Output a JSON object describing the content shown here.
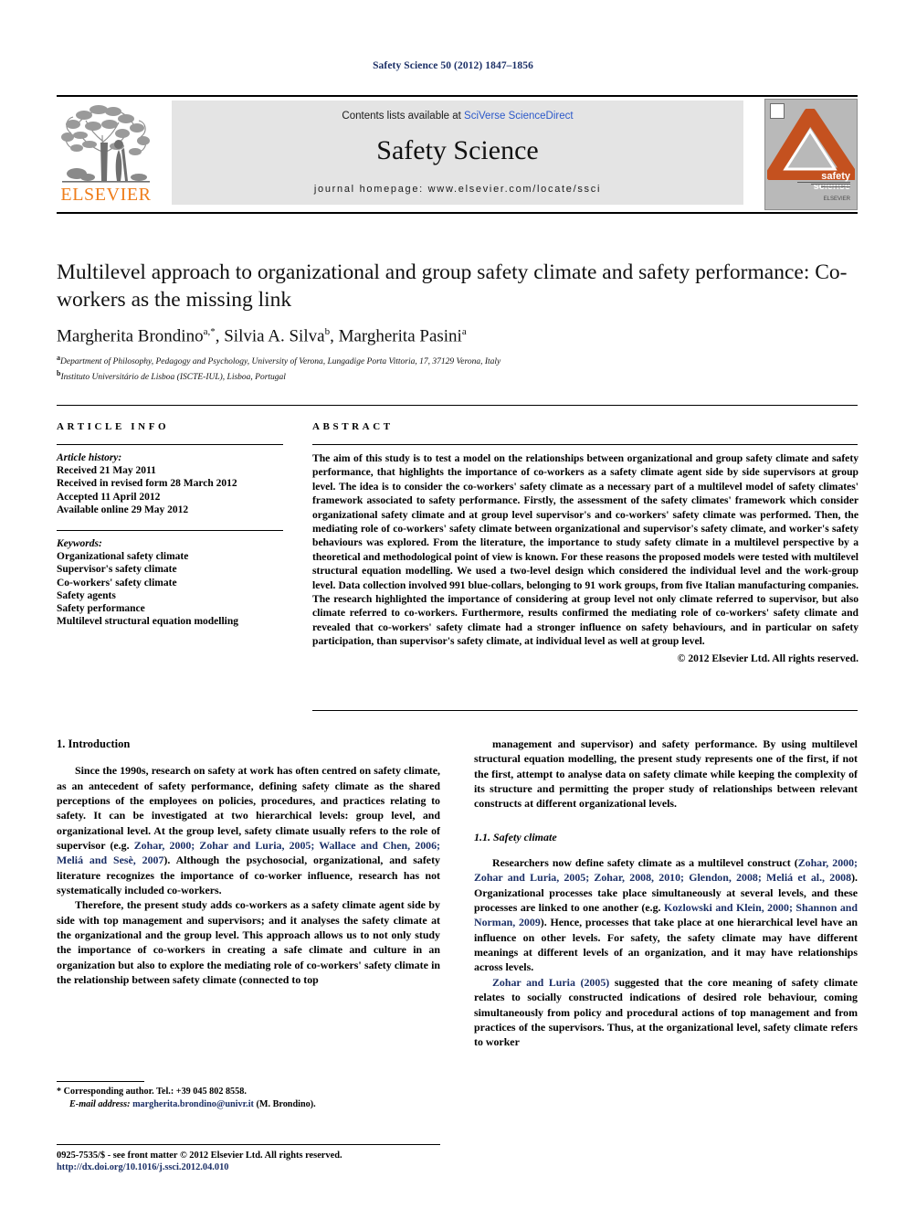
{
  "running_head": "Safety Science 50 (2012) 1847–1856",
  "masthead": {
    "publisher_wordmark": "ELSEVIER",
    "publisher_logo_icon": "elsevier-tree-icon",
    "contents_prefix": "Contents lists available at ",
    "contents_link": "SciVerse ScienceDirect",
    "journal_name": "Safety Science",
    "homepage": "journal homepage: www.elsevier.com/locate/ssci",
    "cover": {
      "title_line1": "safety",
      "title_line2": "science",
      "publisher_small": "ELSEVIER",
      "accent_color": "#c4511f",
      "background_color": "#b9b9b9"
    }
  },
  "article": {
    "title": "Multilevel approach to organizational and group safety climate and safety performance: Co-workers as the missing link",
    "authors": [
      {
        "name": "Margherita Brondino",
        "marks": "a,*"
      },
      {
        "name": "Silvia A. Silva",
        "marks": "b"
      },
      {
        "name": "Margherita Pasini",
        "marks": "a"
      }
    ],
    "affiliations": [
      {
        "mark": "a",
        "text": "Department of Philosophy, Pedagogy and Psychology, University of Verona, Lungadige Porta Vittoria, 17, 37129 Verona, Italy"
      },
      {
        "mark": "b",
        "text": "Instituto Universitário de Lisboa (ISCTE-IUL), Lisboa, Portugal"
      }
    ]
  },
  "article_info": {
    "heading": "ARTICLE INFO",
    "history_label": "Article history:",
    "history": [
      "Received 21 May 2011",
      "Received in revised form 28 March 2012",
      "Accepted 11 April 2012",
      "Available online 29 May 2012"
    ],
    "keywords_label": "Keywords:",
    "keywords": [
      "Organizational safety climate",
      "Supervisor's safety climate",
      "Co-workers' safety climate",
      "Safety agents",
      "Safety performance",
      "Multilevel structural equation modelling"
    ]
  },
  "abstract": {
    "heading": "ABSTRACT",
    "text": "The aim of this study is to test a model on the relationships between organizational and group safety climate and safety performance, that highlights the importance of co-workers as a safety climate agent side by side supervisors at group level. The idea is to consider the co-workers' safety climate as a necessary part of a multilevel model of safety climates' framework associated to safety performance. Firstly, the assessment of the safety climates' framework which consider organizational safety climate and at group level supervisor's and co-workers' safety climate was performed. Then, the mediating role of co-workers' safety climate between organizational and supervisor's safety climate, and worker's safety behaviours was explored. From the literature, the importance to study safety climate in a multilevel perspective by a theoretical and methodological point of view is known. For these reasons the proposed models were tested with multilevel structural equation modelling. We used a two-level design which considered the individual level and the work-group level. Data collection involved 991 blue-collars, belonging to 91 work groups, from five Italian manufacturing companies. The research highlighted the importance of considering at group level not only climate referred to supervisor, but also climate referred to co-workers. Furthermore, results confirmed the mediating role of co-workers' safety climate and revealed that co-workers' safety climate had a stronger influence on safety behaviours, and in particular on safety participation, than supervisor's safety climate, at individual level as well at group level.",
    "copyright": "© 2012 Elsevier Ltd. All rights reserved."
  },
  "body": {
    "section_1_heading": "1. Introduction",
    "left_paragraph_1_a": "Since the 1990s, research on safety at work has often centred on safety climate, as an antecedent of safety performance, defining safety climate as the shared perceptions of the employees on policies, procedures, and practices relating to safety. It can be investigated at two hierarchical levels: group level, and organizational level. At the group level, safety climate usually refers to the role of supervisor (e.g. ",
    "left_paragraph_1_cite": "Zohar, 2000; Zohar and Luria, 2005; Wallace and Chen, 2006; Meliá and Sesè, 2007",
    "left_paragraph_1_b": "). Although the psychosocial, organizational, and safety literature recognizes the importance of co-worker influence, research has not systematically included co-workers.",
    "left_paragraph_2": "Therefore, the present study adds co-workers as a safety climate agent side by side with top management and supervisors; and it analyses the safety climate at the organizational and the group level. This approach allows us to not only study the importance of co-workers in creating a safe climate and culture in an organization but also to explore the mediating role of co-workers' safety climate in the relationship between safety climate (connected to top",
    "right_paragraph_1": "management and supervisor) and safety performance. By using multilevel structural equation modelling, the present study represents one of the first, if not the first, attempt to analyse data on safety climate while keeping the complexity of its structure and permitting the proper study of relationships between relevant constructs at different organizational levels.",
    "section_1_1_heading": "1.1. Safety climate",
    "right_paragraph_2_a": "Researchers now define safety climate as a multilevel construct (",
    "right_paragraph_2_cite1": "Zohar, 2000; Zohar and Luria, 2005; Zohar, 2008, 2010; Glendon, 2008; Meliá et al., 2008",
    "right_paragraph_2_b": "). Organizational processes take place simultaneously at several levels, and these processes are linked to one another (e.g. ",
    "right_paragraph_2_cite2": "Kozlowski and Klein, 2000; Shannon and Norman, 2009",
    "right_paragraph_2_c": "). Hence, processes that take place at one hierarchical level have an influence on other levels. For safety, the safety climate may have different meanings at different levels of an organization, and it may have relationships across levels.",
    "right_paragraph_3_cite": "Zohar and Luria (2005)",
    "right_paragraph_3_text": " suggested that the core meaning of safety climate relates to socially constructed indications of desired role behaviour, coming simultaneously from policy and procedural actions of top management and from practices of the supervisors. Thus, at the organizational level, safety climate refers to worker"
  },
  "footnote": {
    "corresponding": "* Corresponding author. Tel.: +39 045 802 8558.",
    "email_label": "E-mail address:",
    "email": "margherita.brondino@univr.it",
    "email_suffix": " (M. Brondino)."
  },
  "footer": {
    "issn_line": "0925-7535/$ - see front matter © 2012 Elsevier Ltd. All rights reserved.",
    "doi": "http://dx.doi.org/10.1016/j.ssci.2012.04.010"
  }
}
